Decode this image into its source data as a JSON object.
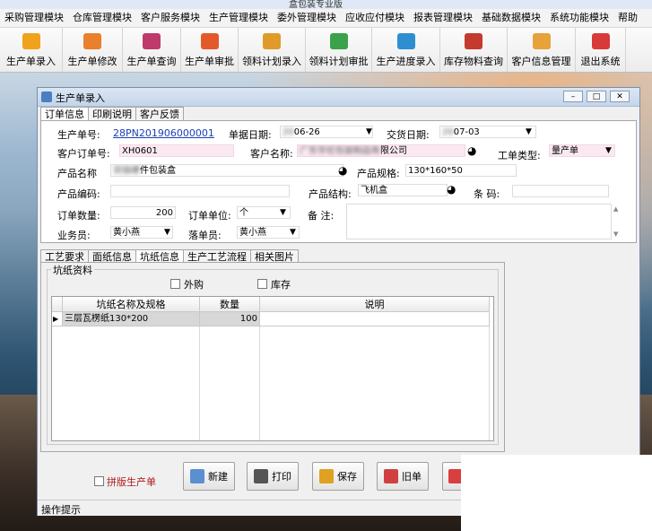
{
  "app_title": "盒包装专业版",
  "menu": [
    "采购管理模块",
    "仓库管理模块",
    "客户服务模块",
    "生产管理模块",
    "委外管理模块",
    "应收应付模块",
    "报表管理模块",
    "基础数据模块",
    "系统功能模块",
    "帮助"
  ],
  "toolbar": [
    {
      "label": "生产单录入",
      "icon": "box-icon",
      "color": "#f0a21c"
    },
    {
      "label": "生产单修改",
      "icon": "gift-icon",
      "color": "#e8802c"
    },
    {
      "label": "生产单查询",
      "icon": "bag-icon",
      "color": "#c0396b"
    },
    {
      "label": "生产单审批",
      "icon": "stamp-icon",
      "color": "#e35a2a"
    },
    {
      "label": "领料计划录入",
      "icon": "hand-icon",
      "color": "#e09a2a"
    },
    {
      "label": "领料计划审批",
      "icon": "blocks-icon",
      "color": "#3aa34a"
    },
    {
      "label": "生产进度录入",
      "icon": "pie-chart-icon",
      "color": "#2e8fd0"
    },
    {
      "label": "库存物料查询",
      "icon": "inventory-icon",
      "color": "#c43a2e"
    },
    {
      "label": "客户信息管理",
      "icon": "contacts-icon",
      "color": "#e8a23a"
    },
    {
      "label": "退出系统",
      "icon": "power-icon",
      "color": "#d83a3a"
    }
  ],
  "window": {
    "title": "生产单录入",
    "controls": [
      "–",
      "□",
      "✕"
    ],
    "tabs": [
      "订单信息",
      "印刷说明",
      "客户反馈"
    ]
  },
  "form": {
    "order_no_label": "生产单号:",
    "order_no": "28PN201906000001",
    "doc_date_label": "单据日期:",
    "doc_date": "06-26",
    "delivery_date_label": "交货日期:",
    "delivery_date": "07-03",
    "customer_order_label": "客户订单号:",
    "customer_order": "XH0601",
    "customer_name_label": "客户名称:",
    "customer_name": "限公司",
    "work_type_label": "工单类型:",
    "work_type": "量产单",
    "product_name_label": "产品名称",
    "product_name": "件包装盒",
    "product_spec_label": "产品规格:",
    "product_spec": "130*160*50",
    "product_code_label": "产品编码:",
    "product_code": "",
    "product_struct_label": "产品结构:",
    "product_struct": "飞机盒",
    "barcode_label": "条 码:",
    "barcode": "",
    "qty_label": "订单数量:",
    "qty": "200",
    "unit_label": "订单单位:",
    "unit": "个",
    "remark_label": "备 注:",
    "remark": "",
    "salesman_label": "业务员:",
    "salesman": "黄小燕",
    "placer_label": "落单员:",
    "placer": "黄小燕"
  },
  "lower_tabs": [
    "工艺要求",
    "面纸信息",
    "坑纸信息",
    "生产工艺流程",
    "相关图片"
  ],
  "group": {
    "title": "坑纸资料",
    "outsource_label": "外购",
    "stock_label": "库存",
    "columns": [
      "坑纸名称及规格",
      "数量",
      "说明"
    ],
    "rows": [
      {
        "name": "三层瓦楞纸130*200",
        "qty": "100",
        "note": ""
      }
    ]
  },
  "bottom": {
    "splice_label": "拼版生产单",
    "buttons": [
      {
        "label": "新建",
        "icon": "new-doc-icon",
        "color": "#5a8fd0"
      },
      {
        "label": "打印",
        "icon": "printer-icon",
        "color": "#555555"
      },
      {
        "label": "保存",
        "icon": "save-icon",
        "color": "#e0a020"
      },
      {
        "label": "旧单",
        "icon": "old-order-icon",
        "color": "#d04040"
      }
    ]
  },
  "status": "操作提示"
}
